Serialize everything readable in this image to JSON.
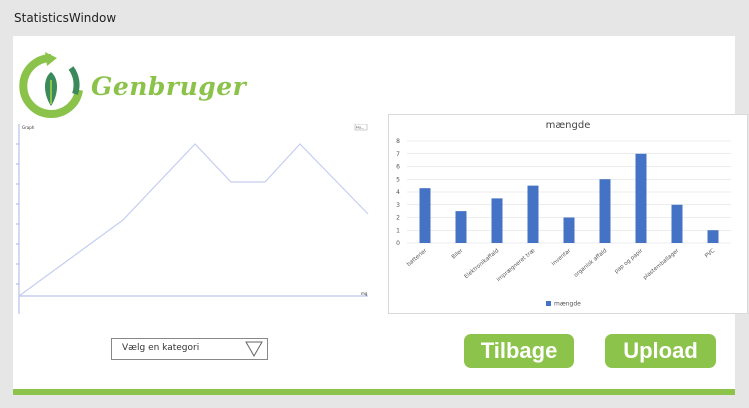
{
  "window": {
    "title": "StatisticsWindow"
  },
  "logo": {
    "text": "Genbruger"
  },
  "line_chart": {
    "title": "Graph",
    "legend_button": "Hu...",
    "x_end_label": "mg"
  },
  "chart_data": {
    "type": "bar",
    "title": "mængde",
    "categories": [
      "batterier",
      "Biler",
      "Elektronikaffald",
      "imprægneret træ",
      "inventar",
      "organisk affald",
      "pap og papir",
      "plastemballager",
      "PVC"
    ],
    "series": [
      {
        "name": "mængde",
        "values": [
          4.3,
          2.5,
          3.5,
          4.5,
          2,
          5,
          7,
          3,
          1
        ],
        "color": "#4472c4"
      }
    ],
    "ylim": [
      0,
      8
    ],
    "yticks": [
      0,
      1,
      2,
      3,
      4,
      5,
      6,
      7,
      8
    ],
    "legend": "bottom",
    "grid": true
  },
  "controls": {
    "dropdown_placeholder": "Vælg en kategori",
    "back_label": "Tilbage",
    "upload_label": "Upload"
  },
  "colors": {
    "accent": "#8cc34a",
    "bar": "#4472c4",
    "line": "#c5cdf2"
  }
}
